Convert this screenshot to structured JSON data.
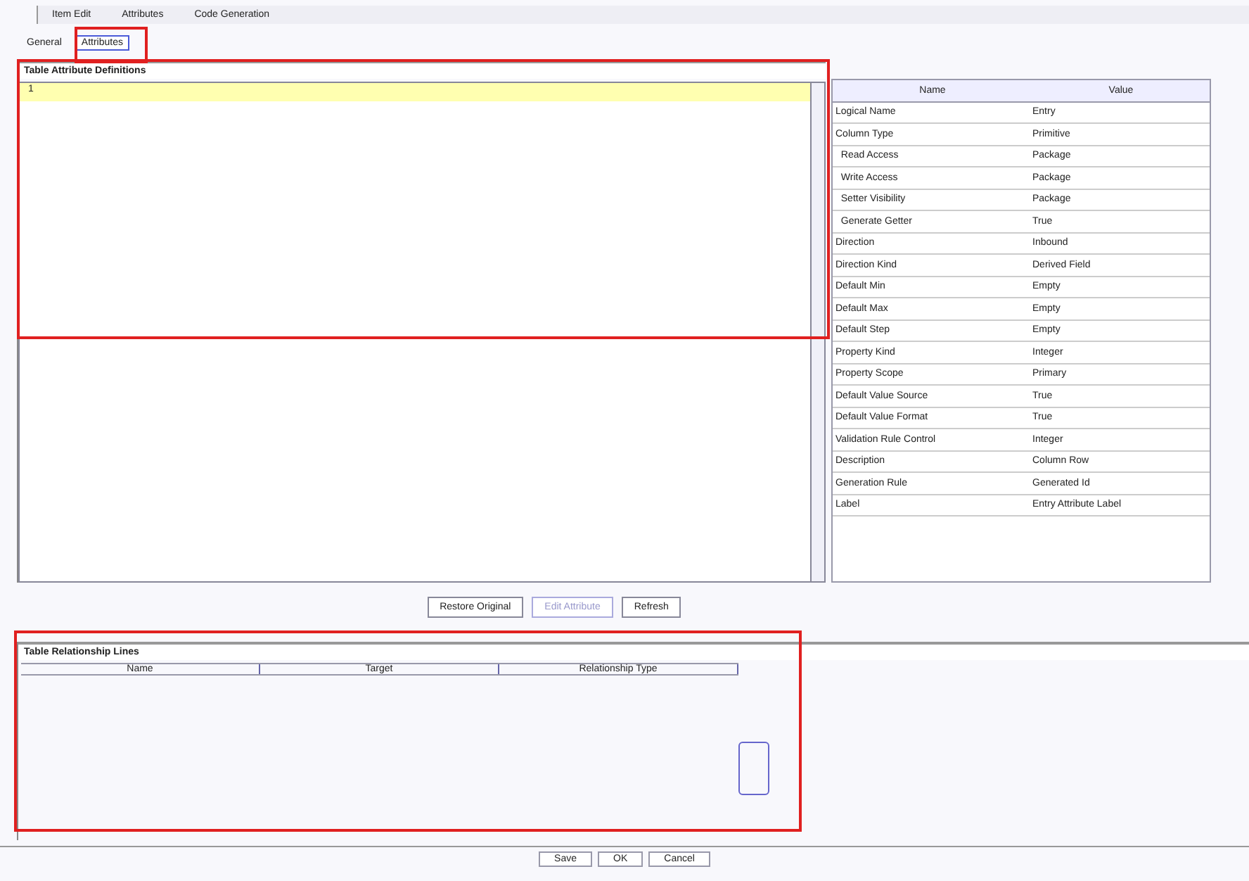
{
  "menu": [
    "Item Edit",
    "Attributes",
    "Code Generation"
  ],
  "tabs": [
    {
      "label": "General",
      "selected": false
    },
    {
      "label": "Attributes",
      "selected": true
    }
  ],
  "upper_panel": {
    "title": "Table Attribute Definitions",
    "list": [
      {
        "text": "1",
        "selected": true
      }
    ]
  },
  "properties": {
    "columns": [
      "Name",
      "Value"
    ],
    "rows": [
      {
        "name": "Logical Name",
        "value": "Entry"
      },
      {
        "name": "Column Type",
        "value": "Primitive"
      },
      {
        "name": "  Read Access",
        "value": "Package"
      },
      {
        "name": "  Write Access",
        "value": "Package"
      },
      {
        "name": "  Setter Visibility",
        "value": "Package"
      },
      {
        "name": "  Generate Getter",
        "value": "True"
      },
      {
        "name": "Direction",
        "value": "Inbound"
      },
      {
        "name": "Direction Kind",
        "value": "Derived Field"
      },
      {
        "name": "Default Min",
        "value": "Empty"
      },
      {
        "name": "Default Max",
        "value": "Empty"
      },
      {
        "name": "Default Step",
        "value": "Empty"
      },
      {
        "name": "Property Kind",
        "value": "Integer"
      },
      {
        "name": "Property Scope",
        "value": "Primary"
      },
      {
        "name": "Default Value Source",
        "value": "True"
      },
      {
        "name": "Default Value Format",
        "value": "True"
      },
      {
        "name": "Validation Rule Control",
        "value": "Integer"
      },
      {
        "name": "Description",
        "value": "Column Row"
      },
      {
        "name": "Generation Rule",
        "value": "Generated Id"
      },
      {
        "name": "Label",
        "value": "Entry Attribute Label"
      }
    ]
  },
  "actions": [
    {
      "label": "Restore Original",
      "disabled": false
    },
    {
      "label": "Edit Attribute",
      "disabled": true
    },
    {
      "label": "Refresh",
      "disabled": false
    }
  ],
  "lower_panel": {
    "title": "Table Relationship Lines",
    "columns": [
      "Name",
      "Target",
      "Relationship Type"
    ]
  },
  "footer_buttons": [
    "Save",
    "OK",
    "Cancel"
  ]
}
